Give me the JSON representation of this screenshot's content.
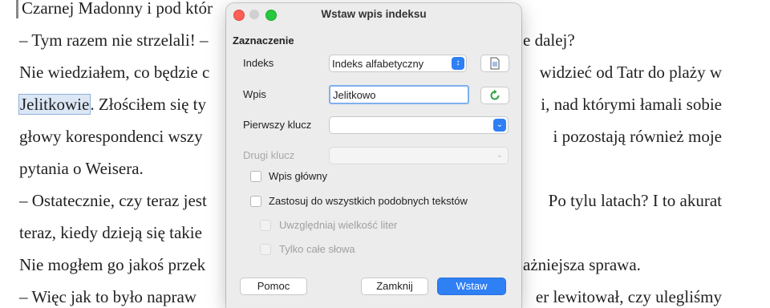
{
  "document": {
    "lines": [
      {
        "before": "Czarnej Madonny i pod któr",
        "highlight": "",
        "after": ""
      },
      {
        "before": "– Tym razem nie strzelali! –",
        "highlight": "",
        "after": ""
      },
      {
        "before": "Nie wiedziałem, co będzie c",
        "highlight": "",
        "after": ""
      },
      {
        "before": "",
        "highlight": "Jelitkowie",
        "after": ". Złościłem się ty"
      },
      {
        "before": "głowy korespondenci wszy",
        "highlight": "",
        "after": ""
      },
      {
        "before": "pytania o Weisera.",
        "highlight": "",
        "after": ""
      },
      {
        "before": "– Ostatecznie, czy teraz jest",
        "highlight": "",
        "after": ""
      },
      {
        "before": "teraz, kiedy dzieją się takie",
        "highlight": "",
        "after": ""
      },
      {
        "before": "Nie mogłem go jakoś przek",
        "highlight": "",
        "after": ""
      },
      {
        "before": "– Więc jak to było napraw",
        "highlight": "",
        "after": ""
      }
    ],
    "right_lines": [
      "e dalej?",
      "widzieć od Tatr do plaży w",
      "i, nad którymi łamali sobie",
      "i pozostają również moje",
      "Po tylu latach? I to akurat",
      "ażniejsza sprawa.",
      "er lewitował, czy ulegliśmy"
    ]
  },
  "dialog": {
    "title": "Wstaw wpis indeksu",
    "section": "Zaznaczenie",
    "index_label": "Indeks",
    "index_value": "Indeks alfabetyczny",
    "entry_label": "Wpis",
    "entry_value": "Jelitkowo",
    "key1_label": "Pierwszy klucz",
    "key1_value": "",
    "key2_label": "Drugi klucz",
    "key2_value": "",
    "main_entry_label": "Wpis główny",
    "apply_all_label": "Zastosuj do wszystkich podobnych tekstów",
    "match_case_label": "Uwzględniaj wielkość liter",
    "whole_words_label": "Tylko całe słowa",
    "help_button": "Pomoc",
    "close_button": "Zamknij",
    "insert_button": "Wstaw"
  },
  "colors": {
    "accent": "#2f7ff5",
    "close_light": "#ff5f57",
    "zoom_light": "#28c840",
    "refresh_icon": "#2ea043"
  },
  "icons": [
    "dropdown-chevron-icon",
    "new-index-icon",
    "refresh-icon"
  ]
}
